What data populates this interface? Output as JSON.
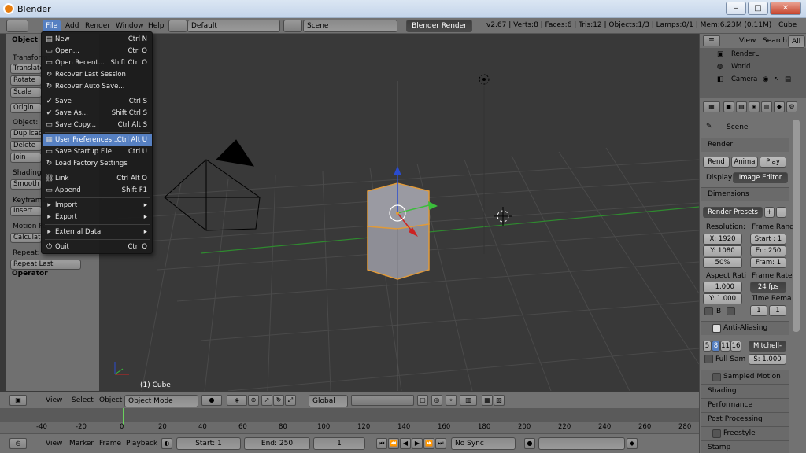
{
  "window": {
    "title": "Blender",
    "min": "–",
    "max": "□",
    "close": "✕"
  },
  "info_header": {
    "menus": [
      "File",
      "Add",
      "Render",
      "Window",
      "Help"
    ],
    "screen_layout": "Default",
    "scene": "Scene",
    "engine": "Blender Render",
    "stats": "v2.67 | Verts:8 | Faces:6 | Tris:12 | Objects:1/3 | Lamps:0/1 | Mem:6.23M (0.11M) | Cube"
  },
  "file_menu": {
    "items": [
      {
        "label": "New",
        "shortcut": "Ctrl N",
        "icon": "▤"
      },
      {
        "label": "Open...",
        "shortcut": "Ctrl O",
        "icon": "▭"
      },
      {
        "label": "Open Recent...",
        "shortcut": "Shift Ctrl O",
        "icon": "▭"
      },
      {
        "label": "Recover Last Session",
        "shortcut": "",
        "icon": "↻"
      },
      {
        "label": "Recover Auto Save...",
        "shortcut": "",
        "icon": "↻"
      },
      {
        "label": "Save",
        "shortcut": "Ctrl S",
        "icon": "✔"
      },
      {
        "label": "Save As...",
        "shortcut": "Shift Ctrl S",
        "icon": "✔"
      },
      {
        "label": "Save Copy...",
        "shortcut": "Ctrl Alt S",
        "icon": "▭"
      },
      {
        "label": "User Preferences...",
        "shortcut": "Ctrl Alt U",
        "icon": "▦"
      },
      {
        "label": "Save Startup File",
        "shortcut": "Ctrl U",
        "icon": "▭"
      },
      {
        "label": "Load Factory Settings",
        "shortcut": "",
        "icon": "↻"
      },
      {
        "label": "Link",
        "shortcut": "Ctrl Alt O",
        "icon": "⛓"
      },
      {
        "label": "Append",
        "shortcut": "Shift F1",
        "icon": "▭"
      },
      {
        "label": "Import",
        "shortcut": "",
        "icon": "▸"
      },
      {
        "label": "Export",
        "shortcut": "",
        "icon": "▸"
      },
      {
        "label": "External Data",
        "shortcut": "",
        "icon": "▸"
      },
      {
        "label": "Quit",
        "shortcut": "Ctrl Q",
        "icon": "⏻"
      }
    ]
  },
  "tool_shelf": {
    "object_header": "Object",
    "transform": "Transform:",
    "translate": "Translate",
    "rotate": "Rotate",
    "scale": "Scale",
    "origin": "Origin",
    "object_label": "Object:",
    "duplicate": "Duplicate",
    "delete": "Delete",
    "join": "Join",
    "shading": "Shading:",
    "smooth": "Smooth",
    "keyframes": "Keyframe",
    "insert": "Insert",
    "motion_paths": "Motion Pa",
    "calculate": "Calculate",
    "repeat": "Repeat:",
    "repeat_last": "Repeat Last",
    "operator": "Operator"
  },
  "viewport": {
    "object_label": "(1) Cube"
  },
  "viewport_header": {
    "view": "View",
    "select": "Select",
    "object": "Object",
    "mode": "Object Mode",
    "orientation": "Global"
  },
  "timeline": {
    "ticks": [
      "-40",
      "-20",
      "0",
      "20",
      "40",
      "60",
      "80",
      "100",
      "120",
      "140",
      "160",
      "180",
      "200",
      "220",
      "240",
      "260",
      "280"
    ],
    "current_frame": 1,
    "header": {
      "view": "View",
      "marker": "Marker",
      "frame": "Frame",
      "playback": "Playback",
      "start": "Start: 1",
      "end": "End: 250",
      "frame_value": "1",
      "sync": "No Sync"
    }
  },
  "outliner": {
    "view": "View",
    "search": "Search",
    "all": "All",
    "rows": [
      "RenderL",
      "World",
      "Camera"
    ]
  },
  "properties": {
    "scene": "Scene",
    "render_panel": "Render",
    "render_btn": "Rend",
    "anim_btn": "Anima",
    "play_btn": "Play",
    "display_label": "Display",
    "display_value": "Image Editor",
    "dimensions_panel": "Dimensions",
    "render_presets": "Render Presets",
    "resolution": "Resolution:",
    "frame_range": "Frame Rang",
    "res_x": "X: 1920",
    "res_y": "Y: 1080",
    "res_pct": "50%",
    "start": "Start : 1",
    "end": "En: 250",
    "frame": "Fram: 1",
    "aspect": "Aspect Rati",
    "frame_rate": "Frame Rate:",
    "aspect_x": ": 1.000",
    "aspect_y": "Y: 1.000",
    "fps": "24 fps",
    "time_remap": "Time Rema",
    "b_label": "B",
    "remap_old": "1",
    "remap_new": "1",
    "aa_panel": "Anti-Aliasing",
    "aa_5": "5",
    "aa_8": "8",
    "aa_11": "11",
    "aa_16": "16",
    "filter": "Mitchell-",
    "full_sample": "Full Sam",
    "size": "S: 1.000",
    "sampled_mb": "Sampled Motion Blur",
    "shading_panel": "Shading",
    "performance_panel": "Performance",
    "post_panel": "Post Processing",
    "freestyle_panel": "Freestyle",
    "stamp_panel": "Stamp"
  }
}
